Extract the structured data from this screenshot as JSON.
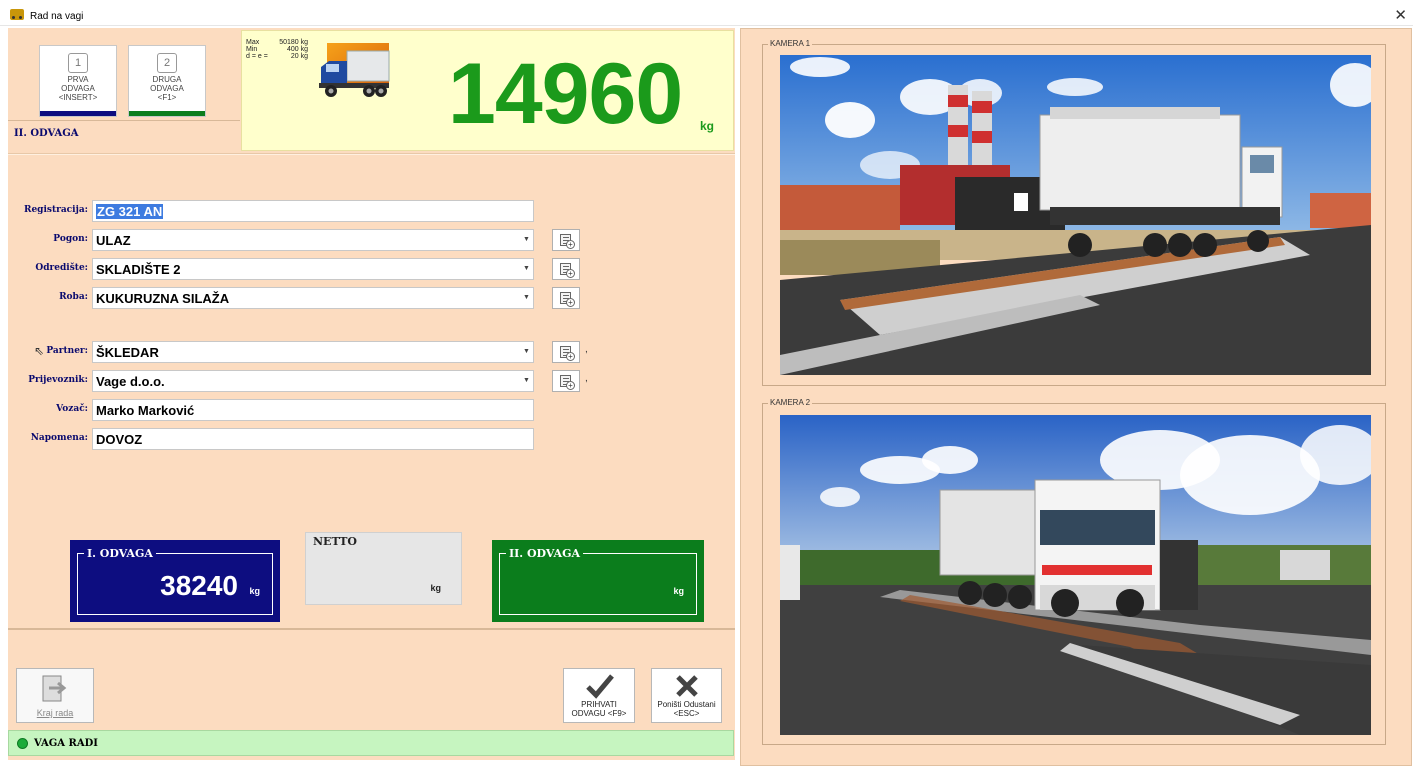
{
  "window": {
    "title": "Rad na vagi"
  },
  "steps": {
    "first": {
      "num": "1",
      "label": "PRVA\nODVAGA\n<INSERT>"
    },
    "second": {
      "num": "2",
      "label": "DRUGA\nODVAGA\n<F1>"
    },
    "current": "II. ODVAGA"
  },
  "scale": {
    "max_label": "Max",
    "max_value": "50180 kg",
    "min_label": "Min",
    "min_value": "400 kg",
    "d_label": "d = e =",
    "d_value": "20 kg",
    "weight": "14960",
    "unit": "kg"
  },
  "form": {
    "registracija": {
      "label": "Registracija:",
      "value": "ZG 321 AN"
    },
    "pogon": {
      "label": "Pogon:",
      "value": "ULAZ"
    },
    "odrediste": {
      "label": "Odredište:",
      "value": "SKLADIŠTE 2"
    },
    "roba": {
      "label": "Roba:",
      "value": "KUKURUZNA SILAŽA"
    },
    "partner": {
      "label": "Partner:",
      "value": "ŠKLEDAR"
    },
    "prijevoznik": {
      "label": "Prijevoznik:",
      "value": "Vage d.o.o."
    },
    "vozac": {
      "label": "Vozač:",
      "value": "Marko Marković"
    },
    "napomena": {
      "label": "Napomena:",
      "value": "DOVOZ"
    },
    "tick": ","
  },
  "weights": {
    "first": {
      "label": "I. ODVAGA",
      "value": "38240",
      "unit": "kg"
    },
    "netto": {
      "label": "NETTO",
      "value": "",
      "unit": "kg"
    },
    "second": {
      "label": "II. ODVAGA",
      "value": "",
      "unit": "kg"
    }
  },
  "actions": {
    "exit": "Kraj rada",
    "accept": "PRIHVATI\nODVAGU <F9>",
    "cancel": "Poništi Odustani\n<ESC>"
  },
  "status": {
    "text": "VAGA RADI",
    "color": "#1cab3a"
  },
  "cameras": {
    "cam1": "KAMERA 1",
    "cam2": "KAMERA 2"
  },
  "colors": {
    "panel_bg": "#fcdcc0",
    "weight_green": "#1b9a1b",
    "first_box": "#0d0d80",
    "second_box": "#0b7d1c",
    "netto_box": "#e6e6e6"
  }
}
